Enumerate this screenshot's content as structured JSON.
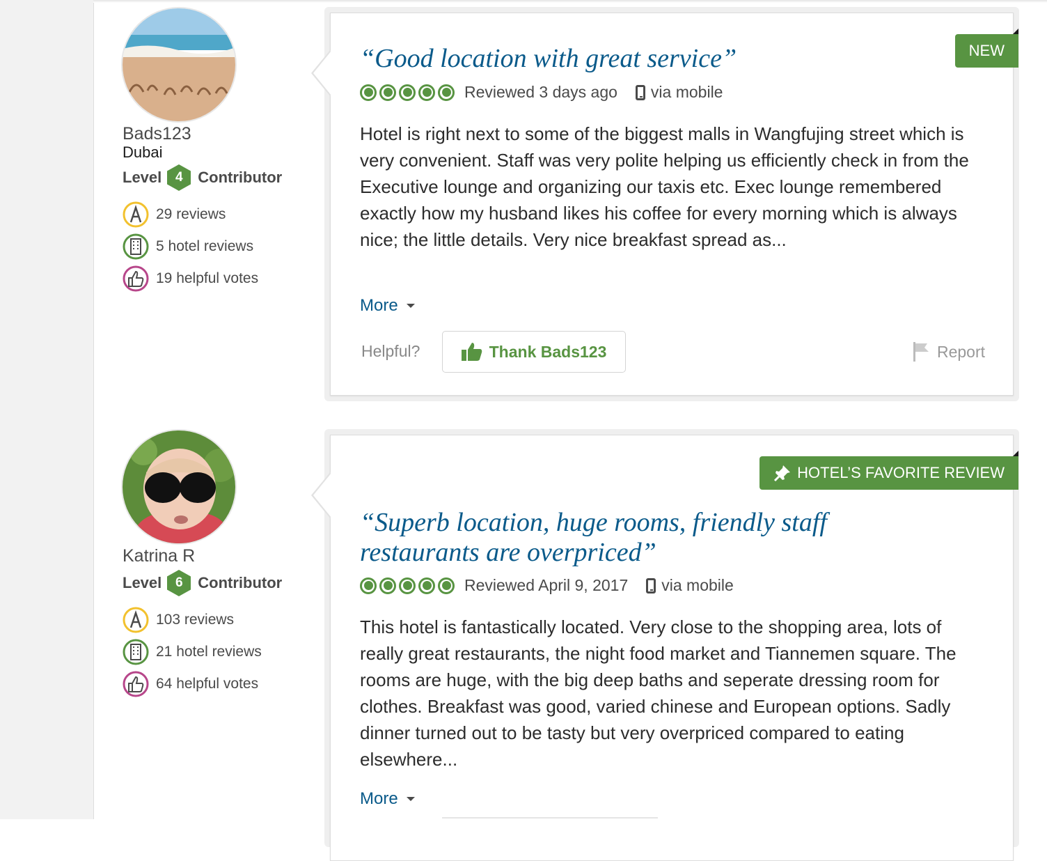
{
  "reviews": [
    {
      "reviewer": {
        "name": "Bads123",
        "location": "Dubai",
        "level_prefix": "Level",
        "level": "4",
        "level_suffix": "Contributor",
        "reviews": "29 reviews",
        "hotel_reviews": "5 hotel reviews",
        "helpful_votes": "19 helpful votes",
        "avatar_icon": "beach-holiday-photo"
      },
      "flag": "NEW",
      "title": "“Good location with great service”",
      "rating": 5,
      "reviewed": "Reviewed 3 days ago",
      "via": "via mobile",
      "text": "Hotel is right next to some of the biggest malls in Wangfujing street which is very convenient. Staff was very polite helping us efficiently check in from the Executive lounge and organizing our taxis etc. Exec lounge remembered exactly how my husband likes his coffee for every morning which is always nice; the little details. Very nice breakfast spread as...",
      "more": "More",
      "helpful_label": "Helpful?",
      "thank_label": "Thank Bads123",
      "report_label": "Report"
    },
    {
      "reviewer": {
        "name": "Katrina R",
        "level_prefix": "Level",
        "level": "6",
        "level_suffix": "Contributor",
        "reviews": "103 reviews",
        "hotel_reviews": "21 hotel reviews",
        "helpful_votes": "64 helpful votes",
        "avatar_icon": "child-sunglasses-photo"
      },
      "flag": "HOTEL’S FAVORITE REVIEW",
      "title_line1": "“Superb location, huge rooms, friendly staff",
      "title_line2": "restaurants are overpriced”",
      "rating": 5,
      "reviewed": "Reviewed April 9, 2017",
      "via": "via mobile",
      "text": "This hotel is fantastically located. Very close to the shopping area, lots of really great restaurants, the night food market and Tiannemen square. The rooms are huge, with the big deep baths and seperate dressing room for clothes. Breakfast was good, varied chinese and European options. Sadly dinner turned out to be tasty but very overpriced compared to eating elsewhere...",
      "more": "More"
    }
  ],
  "colors": {
    "accent_green": "#589442",
    "link_blue": "#0a5a8a",
    "text_gray": "#4a4a4a",
    "reviews_icon_ring": "#f2c12e",
    "hotel_icon_ring": "#589442",
    "votes_icon_ring": "#b7468a"
  }
}
